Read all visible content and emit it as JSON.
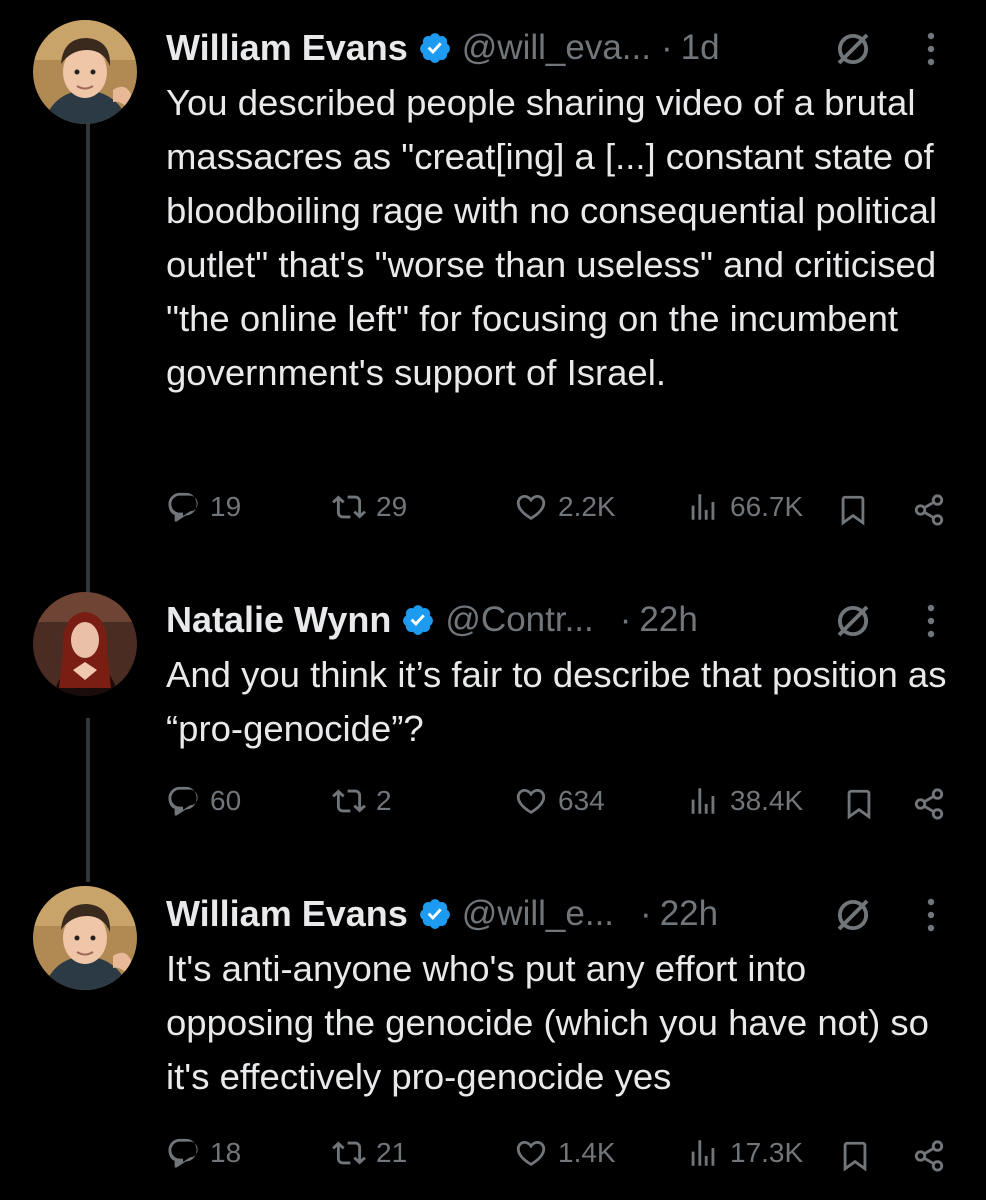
{
  "colors": {
    "background": "#000000",
    "text": "#e7e9ea",
    "muted": "#71767b",
    "verified": "#1d9bf0",
    "thread_line": "#333639"
  },
  "icons": {
    "reply": "reply-icon",
    "retweet": "retweet-icon",
    "like": "heart-icon",
    "views": "views-icon",
    "bookmark": "bookmark-icon",
    "share": "share-icon",
    "verified": "verified-badge-icon",
    "grok": "grok-icon",
    "more": "more-icon"
  },
  "tweets": [
    {
      "name": "William Evans",
      "handle": "@will_eva...",
      "separator": "·",
      "time": "1d",
      "text": "You described people sharing video of a brutal massacres as \"creat[ing] a [...] constant state of bloodboiling rage with no consequential political outlet\" that's \"worse than useless\" and criticised \"the online left\" for focusing on the incumbent government's support of Israel.",
      "replies": "19",
      "retweets": "29",
      "likes": "2.2K",
      "views": "66.7K"
    },
    {
      "name": "Natalie Wynn",
      "handle": "@Contr...",
      "separator": "·",
      "time": "22h",
      "text": "And you think it’s fair to describe that position as “pro-genocide”?",
      "replies": "60",
      "retweets": "2",
      "likes": "634",
      "views": "38.4K"
    },
    {
      "name": "William Evans",
      "handle": "@will_e...",
      "separator": "·",
      "time": "22h",
      "text": "It's anti-anyone who's put any effort into opposing the genocide (which you have not) so it's effectively pro-genocide yes",
      "replies": "18",
      "retweets": "21",
      "likes": "1.4K",
      "views": "17.3K"
    }
  ]
}
